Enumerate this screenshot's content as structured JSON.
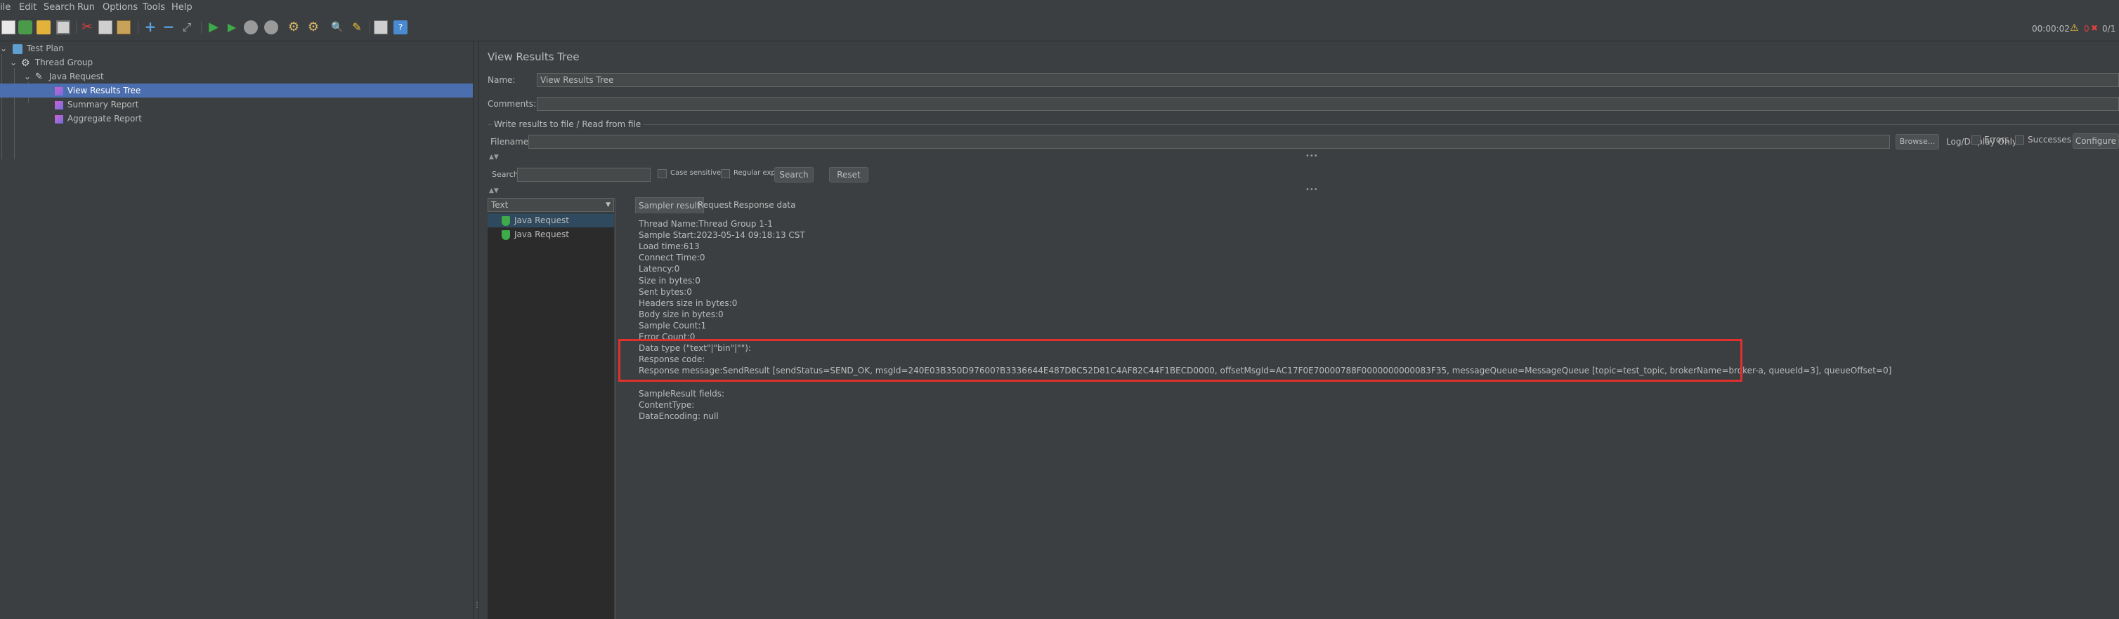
{
  "menu": [
    {
      "label": "File",
      "visible_text": "ile"
    },
    {
      "label": "Edit"
    },
    {
      "label": "Search"
    },
    {
      "label": "Run"
    },
    {
      "label": "Options"
    },
    {
      "label": "Tools"
    },
    {
      "label": "Help"
    }
  ],
  "toolbar": {
    "icons": [
      "new-icon",
      "templates-icon",
      "open-icon",
      "save-icon",
      "cut-icon",
      "copy-icon",
      "paste-icon",
      "expand-icon",
      "collapse-icon",
      "toggle-icon",
      "start-icon",
      "start-no-pause-icon",
      "stop-icon",
      "shutdown-icon",
      "clear-icon",
      "clear-all-icon",
      "search-icon",
      "reset-search-icon",
      "function-helper-icon",
      "help-icon"
    ],
    "elapsed_time": "00:00:02",
    "warning_count": "0",
    "threads": "0/1"
  },
  "tree": {
    "items": [
      {
        "label": "Test Plan",
        "icon": "test-plan-icon"
      },
      {
        "label": "Thread Group",
        "icon": "thread-group-icon"
      },
      {
        "label": "Java Request",
        "icon": "java-request-icon"
      },
      {
        "label": "View Results Tree",
        "icon": "listener-icon"
      },
      {
        "label": "Summary Report",
        "icon": "listener-icon"
      },
      {
        "label": "Aggregate Report",
        "icon": "listener-icon"
      }
    ]
  },
  "panel": {
    "title": "View Results Tree",
    "name_label": "Name:",
    "name_value": "View Results Tree",
    "comments_label": "Comments:",
    "comments_value": "",
    "file_group_label": "Write results to file / Read from file",
    "filename_label": "Filename",
    "filename_value": "",
    "browse_label": "Browse...",
    "log_display_label": "Log/Display Only:",
    "errors_label": "Errors",
    "successes_label": "Successes",
    "configure_label": "Configure",
    "search_label": "Search:",
    "search_value": "",
    "case_sensitive_label": "Case sensitive",
    "regular_exp_label": "Regular exp.",
    "search_button": "Search",
    "reset_button": "Reset",
    "renderer_select": "Text",
    "results": [
      {
        "label": "Java Request",
        "status": "success"
      },
      {
        "label": "Java Request",
        "status": "success"
      }
    ],
    "tabs": [
      "Sampler result",
      "Request",
      "Response data"
    ],
    "sampler_lines": [
      "Thread Name:Thread Group 1-1",
      "Sample Start:2023-05-14 09:18:13 CST",
      "Load time:613",
      "Connect Time:0",
      "Latency:0",
      "Size in bytes:0",
      "Sent bytes:0",
      "Headers size in bytes:0",
      "Body size in bytes:0",
      "Sample Count:1",
      "Error Count:0",
      "Data type (\"text\"|\"bin\"|\"\"):",
      "Response code:",
      "Response message:SendResult [sendStatus=SEND_OK, msgId=240E03B350D97600?B3336644E487D8C52D81C4AF82C44F1BECD0000, offsetMsgId=AC17F0E70000788F0000000000083F35, messageQueue=MessageQueue [topic=test_topic, brokerName=broker-a, queueId=3], queueOffset=0]",
      "",
      "SampleResult fields:",
      "ContentType:",
      "DataEncoding: null"
    ]
  },
  "colors": {
    "background": "#3c3f41",
    "selection": "#4b6eaf",
    "highlight_box": "#e0302e",
    "success": "#3eaa4a"
  }
}
